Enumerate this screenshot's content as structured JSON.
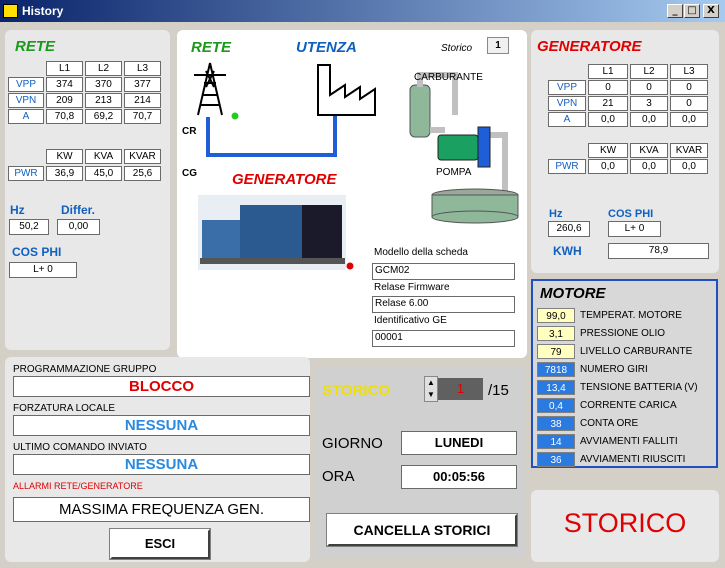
{
  "window": {
    "title": "History",
    "min": "_",
    "max": "□",
    "close": "X"
  },
  "rete": {
    "title": "RETE",
    "cols": [
      "L1",
      "L2",
      "L3"
    ],
    "rows": [
      {
        "label": "VPP",
        "v": [
          "374",
          "370",
          "377"
        ]
      },
      {
        "label": "VPN",
        "v": [
          "209",
          "213",
          "214"
        ]
      },
      {
        "label": "A",
        "v": [
          "70,8",
          "69,2",
          "70,7"
        ]
      }
    ],
    "pwr_cols": [
      "KW",
      "KVA",
      "KVAR"
    ],
    "pwr_label": "PWR",
    "pwr": [
      "36,9",
      "45,0",
      "25,6"
    ],
    "hz_label": "Hz",
    "hz": "50,2",
    "differ_label": "Differ.",
    "differ": "0,00",
    "cosphi_label": "COS PHI",
    "cosphi": "L+ 0"
  },
  "center": {
    "rete": "RETE",
    "utenza": "UTENZA",
    "storico_label": "Storico",
    "storico_val": "1",
    "cr": "CR",
    "cg": "CG",
    "carburante": "CARBURANTE",
    "pompa": "POMPA",
    "generatore": "GENERATORE",
    "modello_label": "Modello della scheda",
    "modello": "GCM02",
    "firmware_label": "Relase Firmware",
    "firmware": "Relase 6.00",
    "id_label": "Identificativo GE",
    "id": "00001"
  },
  "gen": {
    "title": "GENERATORE",
    "cols": [
      "L1",
      "L2",
      "L3"
    ],
    "rows": [
      {
        "label": "VPP",
        "v": [
          "0",
          "0",
          "0"
        ]
      },
      {
        "label": "VPN",
        "v": [
          "21",
          "3",
          "0"
        ]
      },
      {
        "label": "A",
        "v": [
          "0,0",
          "0,0",
          "0,0"
        ]
      }
    ],
    "pwr_cols": [
      "KW",
      "KVA",
      "KVAR"
    ],
    "pwr_label": "PWR",
    "pwr": [
      "0,0",
      "0,0",
      "0,0"
    ],
    "hz_label": "Hz",
    "hz": "260,6",
    "cosphi_label": "COS PHI",
    "cosphi": "L+ 0",
    "kwh_label": "KWH",
    "kwh": "78,9"
  },
  "motore": {
    "title": "MOTORE",
    "rows": [
      {
        "v": "99,0",
        "label": "TEMPERAT. MOTORE",
        "bg": "#ffffc0",
        "fg": "#000"
      },
      {
        "v": "3,1",
        "label": "PRESSIONE OLIO",
        "bg": "#ffffc0",
        "fg": "#000"
      },
      {
        "v": "79",
        "label": "LIVELLO CARBURANTE",
        "bg": "#ffffc0",
        "fg": "#000"
      },
      {
        "v": "7818",
        "label": "NUMERO GIRI",
        "bg": "#2a7ae0",
        "fg": "#fff"
      },
      {
        "v": "13,4",
        "label": "TENSIONE BATTERIA (V)",
        "bg": "#2a7ae0",
        "fg": "#fff"
      },
      {
        "v": "0,4",
        "label": "CORRENTE CARICA",
        "bg": "#2a7ae0",
        "fg": "#fff"
      },
      {
        "v": "38",
        "label": "CONTA ORE",
        "bg": "#2a7ae0",
        "fg": "#fff"
      },
      {
        "v": "14",
        "label": "AVVIAMENTI FALLITI",
        "bg": "#2a7ae0",
        "fg": "#fff"
      },
      {
        "v": "36",
        "label": "AVVIAMENTI RIUSCITI",
        "bg": "#2a7ae0",
        "fg": "#fff"
      }
    ]
  },
  "prog": {
    "label": "PROGRAMMAZIONE GRUPPO",
    "value": "BLOCCO",
    "forz_label": "FORZATURA LOCALE",
    "forz_value": "NESSUNA",
    "ultimo_label": "ULTIMO COMANDO INVIATO",
    "ultimo_value": "NESSUNA",
    "allarmi_label": "ALLARMI RETE/GENERATORE",
    "allarme": "MASSIMA FREQUENZA GEN.",
    "esci": "ESCI"
  },
  "storico": {
    "title": "STORICO",
    "index": "1",
    "total": "/15",
    "giorno_label": "GIORNO",
    "giorno": "LUNEDI",
    "ora_label": "ORA",
    "ora": "00:05:56",
    "cancella": "CANCELLA STORICI",
    "big": "STORICO"
  }
}
